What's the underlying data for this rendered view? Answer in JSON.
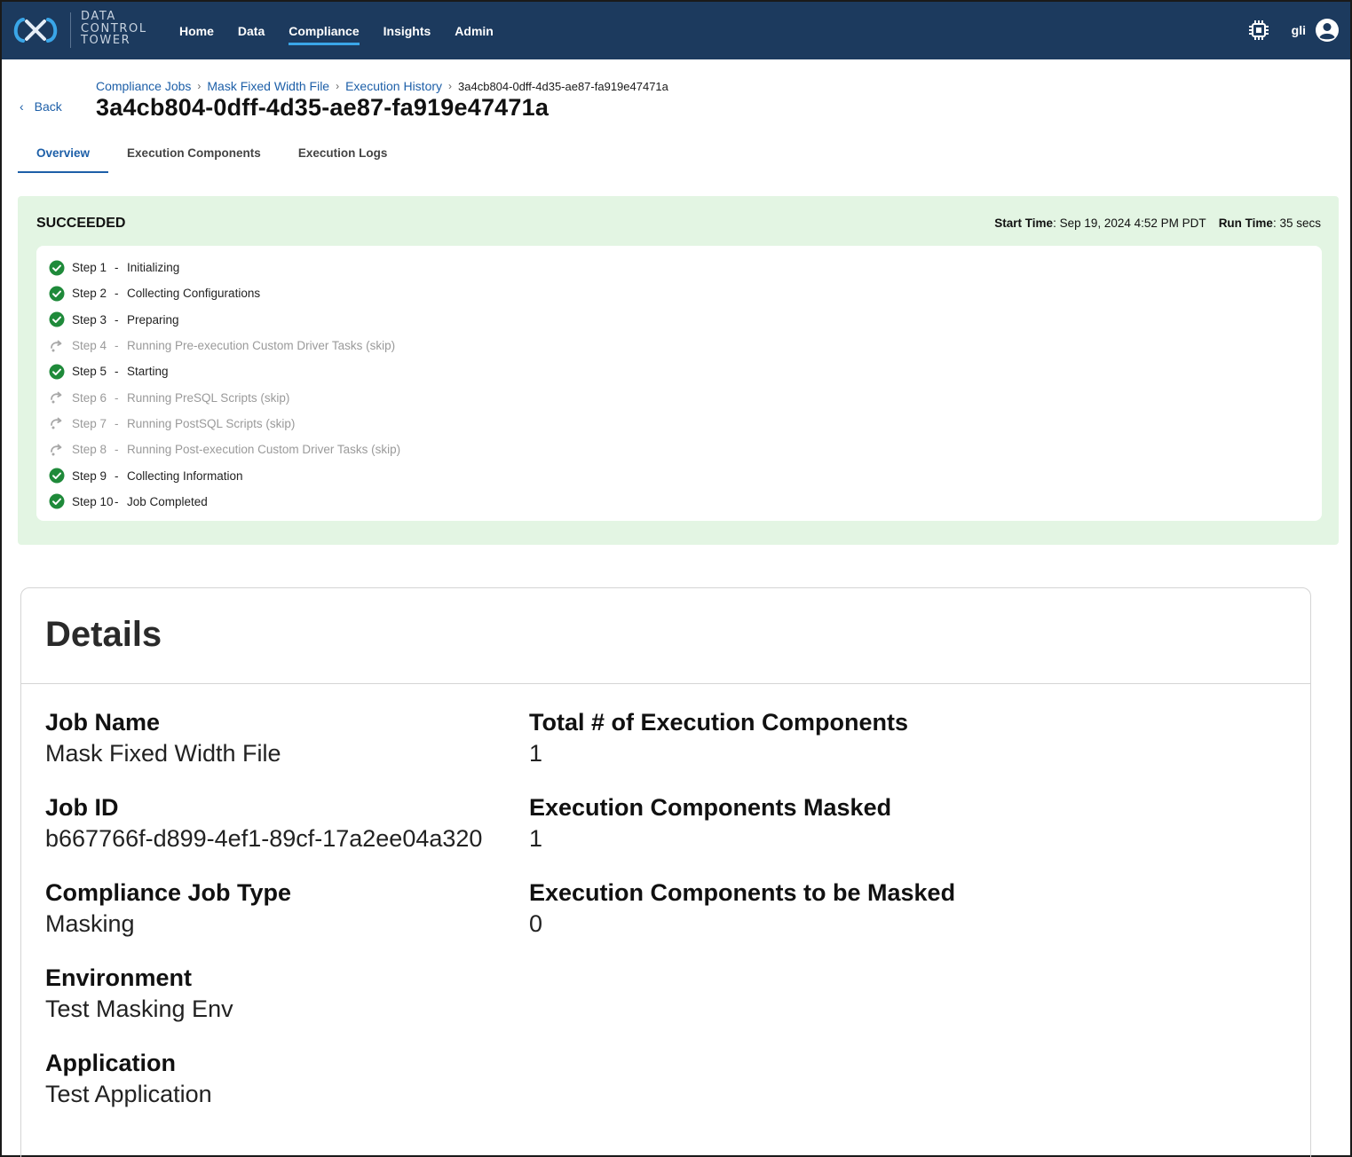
{
  "app": {
    "logo_lines": [
      "DATA",
      "CONTROL",
      "TOWER"
    ],
    "nav": [
      {
        "label": "Home"
      },
      {
        "label": "Data"
      },
      {
        "label": "Compliance"
      },
      {
        "label": "Insights"
      },
      {
        "label": "Admin"
      }
    ],
    "user": "gli",
    "colors": {
      "topbar": "#1c3a5e",
      "accent": "#1d5fa8",
      "success_bg": "#e3f5e3",
      "success_icon": "#1f8a3a"
    }
  },
  "header": {
    "back_label": "Back",
    "breadcrumb": [
      "Compliance Jobs",
      "Mask Fixed Width File",
      "Execution History"
    ],
    "breadcrumb_current": "3a4cb804-0dff-4d35-ae87-fa919e47471a",
    "title": "3a4cb804-0dff-4d35-ae87-fa919e47471a"
  },
  "tabs": [
    {
      "label": "Overview"
    },
    {
      "label": "Execution Components"
    },
    {
      "label": "Execution Logs"
    }
  ],
  "status": {
    "state": "SUCCEEDED",
    "start_time_label": "Start Time",
    "start_time": "Sep 19, 2024 4:52 PM PDT",
    "run_time_label": "Run Time",
    "run_time": "35 secs",
    "steps": [
      {
        "num": "Step 1",
        "dash": "-",
        "label": "Initializing",
        "icon": "check-circle-icon"
      },
      {
        "num": "Step 2",
        "dash": "-",
        "label": "Collecting Configurations",
        "icon": "check-circle-icon"
      },
      {
        "num": "Step 3",
        "dash": "-",
        "label": "Preparing",
        "icon": "check-circle-icon"
      },
      {
        "num": "Step 4",
        "dash": "-",
        "label": "Running Pre-execution Custom Driver Tasks (skip)",
        "icon": "skip-icon"
      },
      {
        "num": "Step 5",
        "dash": "-",
        "label": "Starting",
        "icon": "check-circle-icon"
      },
      {
        "num": "Step 6",
        "dash": "-",
        "label": "Running PreSQL Scripts (skip)",
        "icon": "skip-icon"
      },
      {
        "num": "Step 7",
        "dash": "-",
        "label": "Running PostSQL Scripts (skip)",
        "icon": "skip-icon"
      },
      {
        "num": "Step 8",
        "dash": "-",
        "label": "Running Post-execution Custom Driver Tasks (skip)",
        "icon": "skip-icon"
      },
      {
        "num": "Step 9",
        "dash": "-",
        "label": "Collecting Information",
        "icon": "check-circle-icon"
      },
      {
        "num": "Step 10",
        "dash": "-",
        "label": "Job Completed",
        "icon": "check-circle-icon"
      }
    ]
  },
  "details": {
    "title": "Details",
    "left": [
      {
        "label": "Job Name",
        "value": "Mask Fixed Width File"
      },
      {
        "label": "Job ID",
        "value": "b667766f-d899-4ef1-89cf-17a2ee04a320"
      },
      {
        "label": "Compliance Job Type",
        "value": "Masking"
      },
      {
        "label": "Environment",
        "value": "Test Masking Env"
      },
      {
        "label": "Application",
        "value": "Test Application"
      }
    ],
    "right": [
      {
        "label": "Total # of Execution Components",
        "value": "1"
      },
      {
        "label": "Execution Components Masked",
        "value": "1"
      },
      {
        "label": "Execution Components to be Masked",
        "value": "0"
      }
    ]
  }
}
